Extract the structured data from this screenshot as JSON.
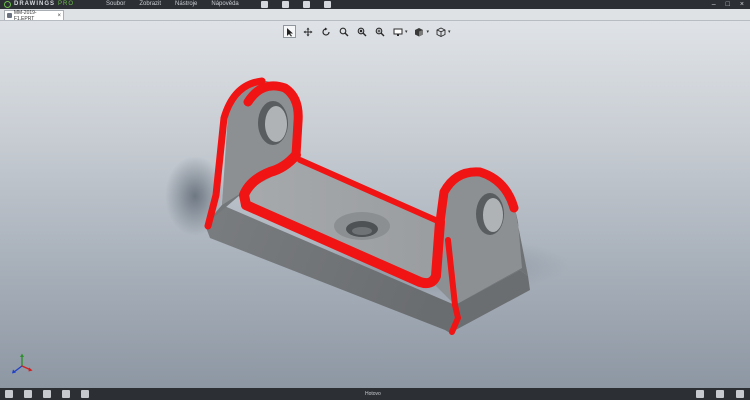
{
  "app": {
    "brand_name": "DRAWINGS",
    "brand_suffix": "PRO"
  },
  "menu": {
    "items": [
      "Soubor",
      "Zobrazit",
      "Nástroje",
      "Nápověda"
    ]
  },
  "document_tab": {
    "label": "MM-2019-F1.EPRT"
  },
  "toolbar": {
    "icons": [
      "select-icon",
      "pan-icon",
      "rotate-icon",
      "zoom-fit-icon",
      "zoom-area-icon",
      "zoom-icon",
      "display-icon",
      "display-style-icon",
      "view-orientation-icon"
    ]
  },
  "status": {
    "text": "Hotovo"
  },
  "colors": {
    "part_body": "#7a7d80",
    "highlight_edges": "#f01414",
    "background_top": "#dfe3e7",
    "background_bottom": "#8d97a3"
  }
}
